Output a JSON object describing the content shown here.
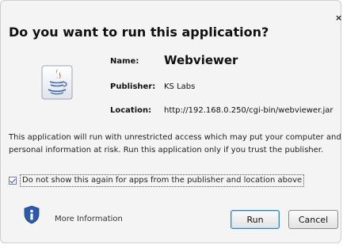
{
  "dialog": {
    "title": "Do you want to run this application?",
    "close_glyph": "×",
    "icon": "java-cup-icon"
  },
  "fields": {
    "name_label": "Name:",
    "name_value": "Webviewer",
    "publisher_label": "Publisher:",
    "publisher_value": "KS Labs",
    "location_label": "Location:",
    "location_value": "http://192.168.0.250/cgi-bin/webviewer.jar"
  },
  "warning": {
    "line1": "This application will run with unrestricted access which may put your computer and",
    "line2": "personal information at risk. Run this application only if you trust the publisher."
  },
  "checkbox": {
    "checked": true,
    "label": "Do not show this again for apps from the publisher and location above"
  },
  "footer": {
    "info_icon": "shield-info-icon",
    "more_info_label": "More Information",
    "run_label": "Run",
    "cancel_label": "Cancel"
  },
  "colors": {
    "dialog_bg": "#f4f4f4",
    "shield_blue": "#2d5aa8",
    "java_red": "#d9541e",
    "java_blue": "#4b6fa7",
    "default_button_border": "#3c7fb1"
  }
}
